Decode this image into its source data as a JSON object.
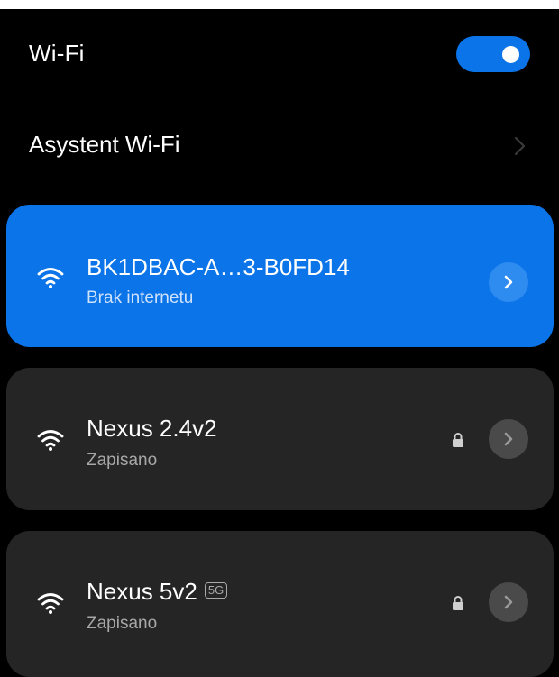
{
  "colors": {
    "accent": "#0a74e8",
    "background": "#000000",
    "card": "#252525",
    "button_gray": "#4a4a4a",
    "muted_text": "#a8a8a8",
    "white": "#ffffff"
  },
  "wifi": {
    "label": "Wi-Fi",
    "enabled": true
  },
  "assistant": {
    "label": "Asystent Wi-Fi"
  },
  "networks": [
    {
      "ssid": "BK1DBAC-A…3-B0FD14",
      "status": "Brak internetu",
      "connected": true,
      "secured": false,
      "badge": ""
    },
    {
      "ssid": "Nexus 2.4v2",
      "status": "Zapisano",
      "connected": false,
      "secured": true,
      "badge": ""
    },
    {
      "ssid": "Nexus 5v2",
      "status": "Zapisano",
      "connected": false,
      "secured": true,
      "badge": "5G"
    }
  ]
}
